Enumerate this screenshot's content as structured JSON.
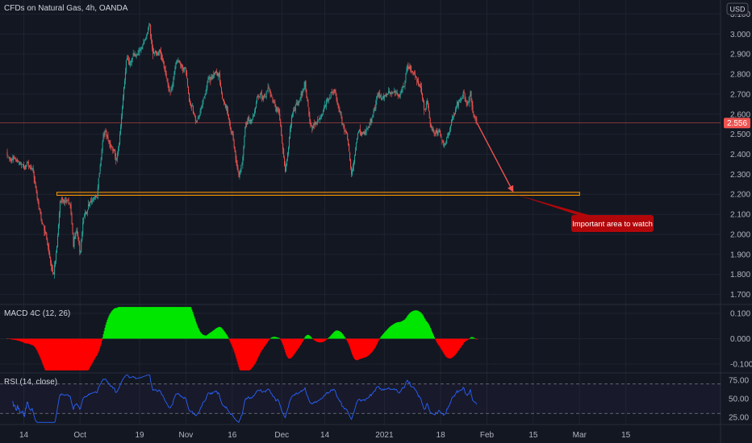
{
  "header": {
    "title": "CFDs on Natural Gas, 4h, OANDA",
    "currency": "USD"
  },
  "colors": {
    "background": "#131722",
    "up": "#26a69a",
    "down": "#ef5350",
    "macd_pos": "#00e600",
    "macd_neg": "#ff0000",
    "rsi_line": "#2962ff",
    "zone": "#ff9800",
    "annotation": "#b2070a"
  },
  "chart_data": [
    {
      "type": "candlestick",
      "name": "price",
      "y_ticks": [
        "3.100",
        "3.000",
        "2.900",
        "2.800",
        "2.700",
        "2.600",
        "2.500",
        "2.400",
        "2.300",
        "2.200",
        "2.100",
        "2.000",
        "1.900",
        "1.800",
        "1.700"
      ],
      "x_ticks": [
        "14",
        "Oct",
        "19",
        "Nov",
        "16",
        "Dec",
        "14",
        "2021",
        "18",
        "Feb",
        "15",
        "Mar",
        "15"
      ],
      "ylim": [
        1.65,
        3.17
      ],
      "last_price": "2.556",
      "close_path": [
        [
          "Sep 9",
          2.4
        ],
        [
          "Sep 13",
          2.34
        ],
        [
          "Sep 15",
          2.36
        ],
        [
          "Sep 17",
          2.29
        ],
        [
          "Sep 18",
          2.2
        ],
        [
          "Sep 21",
          1.96
        ],
        [
          "Sep 22",
          1.85
        ],
        [
          "Sep 23",
          1.8
        ],
        [
          "Sep 24",
          1.93
        ],
        [
          "Sep 25",
          2.16
        ],
        [
          "Sep 28",
          2.17
        ],
        [
          "Sep 29",
          1.95
        ],
        [
          "Sep 30",
          2.02
        ],
        [
          "Oct 1",
          1.91
        ],
        [
          "Oct 2",
          2.07
        ],
        [
          "Oct 5",
          2.2
        ],
        [
          "Oct 6",
          2.19
        ],
        [
          "Oct 8",
          2.51
        ],
        [
          "Oct 9",
          2.48
        ],
        [
          "Oct 12",
          2.38
        ],
        [
          "Oct 13",
          2.5
        ],
        [
          "Oct 14",
          2.69
        ],
        [
          "Oct 15",
          2.88
        ],
        [
          "Oct 16",
          2.86
        ],
        [
          "Oct 19",
          2.93
        ],
        [
          "Oct 20",
          2.96
        ],
        [
          "Oct 21",
          2.99
        ],
        [
          "Oct 22",
          3.06
        ],
        [
          "Oct 23",
          2.92
        ],
        [
          "Oct 26",
          2.87
        ],
        [
          "Oct 27",
          2.78
        ],
        [
          "Oct 28",
          2.7
        ],
        [
          "Oct 29",
          2.76
        ],
        [
          "Oct 30",
          2.86
        ],
        [
          "Nov 2",
          2.82
        ],
        [
          "Nov 3",
          2.68
        ],
        [
          "Nov 4",
          2.63
        ],
        [
          "Nov 5",
          2.55
        ],
        [
          "Nov 6",
          2.6
        ],
        [
          "Nov 9",
          2.78
        ],
        [
          "Nov 10",
          2.8
        ],
        [
          "Nov 11",
          2.84
        ],
        [
          "Nov 12",
          2.82
        ],
        [
          "Nov 13",
          2.7
        ],
        [
          "Nov 16",
          2.5
        ],
        [
          "Nov 17",
          2.37
        ],
        [
          "Nov 18",
          2.29
        ],
        [
          "Nov 19",
          2.35
        ],
        [
          "Nov 20",
          2.55
        ],
        [
          "Nov 23",
          2.62
        ],
        [
          "Nov 24",
          2.67
        ],
        [
          "Nov 25",
          2.68
        ],
        [
          "Nov 27",
          2.72
        ],
        [
          "Nov 30",
          2.6
        ],
        [
          "Dec 1",
          2.45
        ],
        [
          "Dec 2",
          2.3
        ],
        [
          "Dec 3",
          2.45
        ],
        [
          "Dec 4",
          2.6
        ],
        [
          "Dec 7",
          2.7
        ],
        [
          "Dec 8",
          2.75
        ],
        [
          "Dec 9",
          2.62
        ],
        [
          "Dec 10",
          2.53
        ],
        [
          "Dec 11",
          2.55
        ],
        [
          "Dec 14",
          2.65
        ],
        [
          "Dec 15",
          2.68
        ],
        [
          "Dec 16",
          2.7
        ],
        [
          "Dec 17",
          2.74
        ],
        [
          "Dec 18",
          2.63
        ],
        [
          "Dec 21",
          2.45
        ],
        [
          "Dec 22",
          2.3
        ],
        [
          "Dec 23",
          2.35
        ],
        [
          "Dec 24",
          2.47
        ],
        [
          "Dec 28",
          2.55
        ],
        [
          "Dec 29",
          2.62
        ],
        [
          "Dec 30",
          2.7
        ],
        [
          "Dec 31",
          2.67
        ],
        [
          "Jan 4",
          2.71
        ],
        [
          "Jan 5",
          2.65
        ],
        [
          "Jan 6",
          2.7
        ],
        [
          "Jan 7",
          2.75
        ],
        [
          "Jan 8",
          2.85
        ],
        [
          "Jan 11",
          2.76
        ],
        [
          "Jan 12",
          2.72
        ],
        [
          "Jan 13",
          2.62
        ],
        [
          "Jan 14",
          2.68
        ],
        [
          "Jan 15",
          2.55
        ],
        [
          "Jan 18",
          2.5
        ],
        [
          "Jan 19",
          2.45
        ],
        [
          "Jan 20",
          2.48
        ],
        [
          "Jan 21",
          2.55
        ],
        [
          "Jan 22",
          2.62
        ],
        [
          "Jan 25",
          2.7
        ],
        [
          "Jan 26",
          2.65
        ],
        [
          "Jan 27",
          2.68
        ],
        [
          "Jan 28",
          2.58
        ],
        [
          "Jan 29",
          2.556
        ]
      ],
      "zone": {
        "low": 2.195,
        "high": 2.21,
        "from": "Sep 24",
        "to": "Mar 1"
      },
      "arrow": {
        "from": [
          "Jan 29",
          2.556
        ],
        "to": [
          "Feb 9",
          2.21
        ]
      },
      "annotation": "Important area to watch"
    },
    {
      "type": "histogram",
      "name": "MACD 4C (12, 26)",
      "y_ticks": [
        "0.100",
        "0.000",
        "-0.100"
      ],
      "ylim": [
        -0.135,
        0.135
      ]
    },
    {
      "type": "line",
      "name": "RSI (14, close)",
      "y_ticks": [
        "75.00",
        "50.00",
        "25.00"
      ],
      "ylim": [
        15,
        85
      ],
      "bands": [
        70,
        30
      ]
    }
  ]
}
